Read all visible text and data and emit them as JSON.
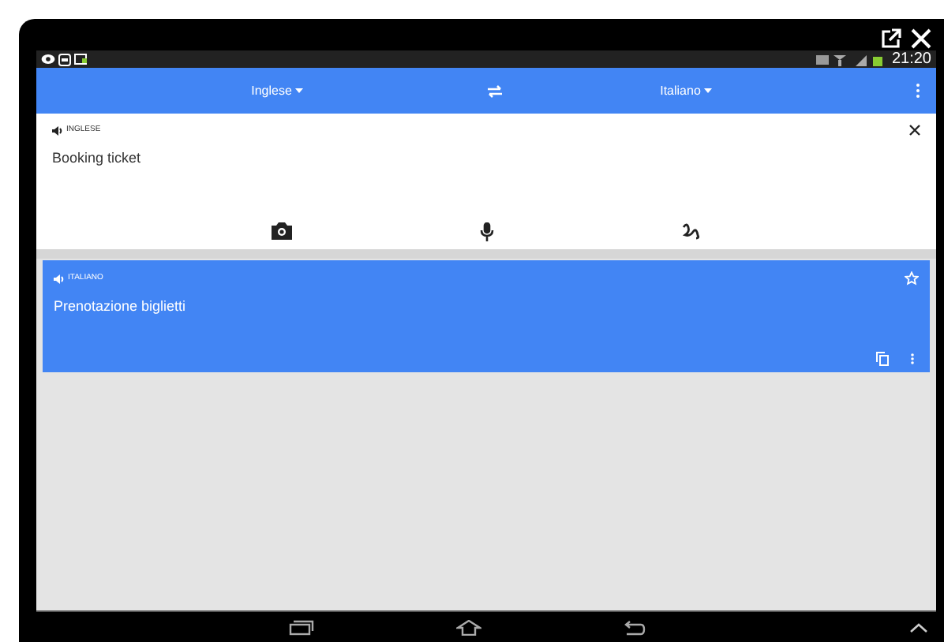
{
  "status_bar": {
    "time": "21:20"
  },
  "language_bar": {
    "source": "Inglese",
    "target": "Italiano"
  },
  "input": {
    "language": "INGLESE",
    "text": "Booking ticket"
  },
  "result": {
    "language": "ITALIANO",
    "text": "Prenotazione biglietti",
    "starred": false
  }
}
